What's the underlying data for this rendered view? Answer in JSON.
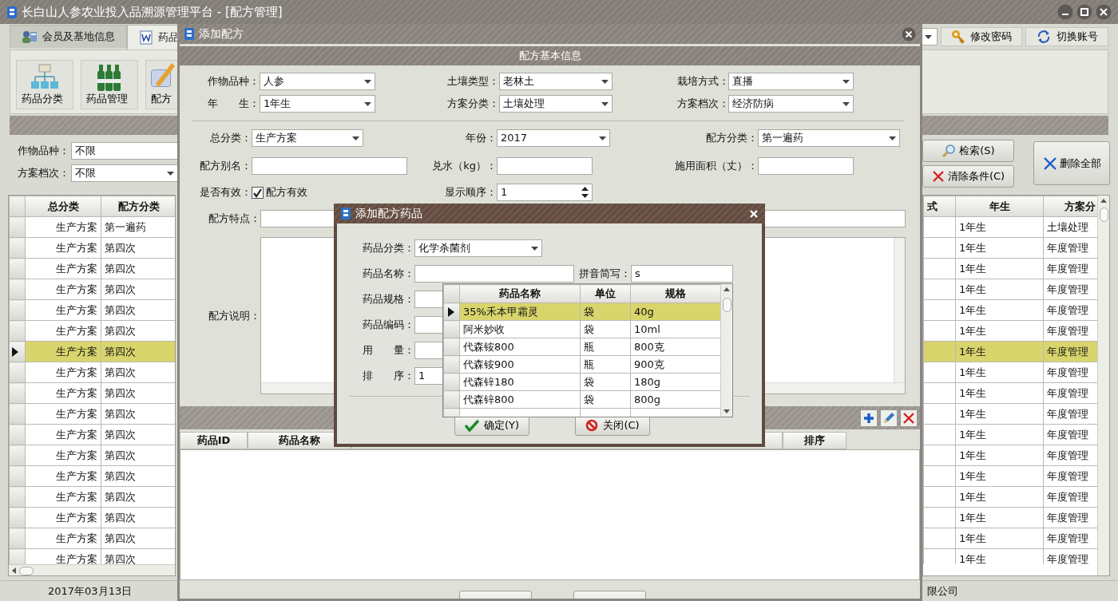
{
  "window": {
    "title": "长白山人参农业投入品溯源管理平台 - [配方管理]"
  },
  "tabs": [
    {
      "label": "会员及基地信息",
      "selected": false
    },
    {
      "label": "药品",
      "selected": true
    }
  ],
  "header_buttons": [
    "修改密码",
    "切换账号"
  ],
  "ribbon": [
    "药品分类",
    "药品管理",
    "配方"
  ],
  "filters": [
    {
      "label": "作物品种：",
      "value": "不限",
      "kind": "text"
    },
    {
      "label": "方案档次：",
      "value": "不限",
      "kind": "combo"
    }
  ],
  "search_buttons": [
    "检索(S)",
    "清除条件(C)"
  ],
  "delete_all_button": "删除全部",
  "records_table": {
    "columns_left": [
      "总分类",
      "配方分类"
    ],
    "columns_right": [
      "式",
      "年生",
      "方案分"
    ],
    "rows": [
      {
        "left": [
          "生产方案",
          "第一遍药"
        ],
        "right": [
          "1年生",
          "土壤处理"
        ],
        "selected": false
      },
      {
        "left": [
          "生产方案",
          "第四次"
        ],
        "right": [
          "1年生",
          "年度管理"
        ],
        "selected": false
      },
      {
        "left": [
          "生产方案",
          "第四次"
        ],
        "right": [
          "1年生",
          "年度管理"
        ],
        "selected": false
      },
      {
        "left": [
          "生产方案",
          "第四次"
        ],
        "right": [
          "1年生",
          "年度管理"
        ],
        "selected": false
      },
      {
        "left": [
          "生产方案",
          "第四次"
        ],
        "right": [
          "1年生",
          "年度管理"
        ],
        "selected": false
      },
      {
        "left": [
          "生产方案",
          "第四次"
        ],
        "right": [
          "1年生",
          "年度管理"
        ],
        "selected": false
      },
      {
        "left": [
          "生产方案",
          "第四次"
        ],
        "right": [
          "1年生",
          "年度管理"
        ],
        "selected": true
      },
      {
        "left": [
          "生产方案",
          "第四次"
        ],
        "right": [
          "1年生",
          "年度管理"
        ],
        "selected": false
      },
      {
        "left": [
          "生产方案",
          "第四次"
        ],
        "right": [
          "1年生",
          "年度管理"
        ],
        "selected": false
      },
      {
        "left": [
          "生产方案",
          "第四次"
        ],
        "right": [
          "1年生",
          "年度管理"
        ],
        "selected": false
      },
      {
        "left": [
          "生产方案",
          "第四次"
        ],
        "right": [
          "1年生",
          "年度管理"
        ],
        "selected": false
      },
      {
        "left": [
          "生产方案",
          "第四次"
        ],
        "right": [
          "1年生",
          "年度管理"
        ],
        "selected": false
      },
      {
        "left": [
          "生产方案",
          "第四次"
        ],
        "right": [
          "1年生",
          "年度管理"
        ],
        "selected": false
      },
      {
        "left": [
          "生产方案",
          "第四次"
        ],
        "right": [
          "1年生",
          "年度管理"
        ],
        "selected": false
      },
      {
        "left": [
          "生产方案",
          "第四次"
        ],
        "right": [
          "1年生",
          "年度管理"
        ],
        "selected": false
      },
      {
        "left": [
          "生产方案",
          "第四次"
        ],
        "right": [
          "1年生",
          "年度管理"
        ],
        "selected": false
      },
      {
        "left": [
          "生产方案",
          "第四次"
        ],
        "right": [
          "1年生",
          "年度管理"
        ],
        "selected": false
      }
    ]
  },
  "status_bar": {
    "date": "2017年03月13日",
    "company": "限公司"
  },
  "recipe_dialog": {
    "title": "添加配方",
    "section": "配方基本信息",
    "form_rows": [
      [
        {
          "label": "作物品种：",
          "kind": "combo",
          "value": "人参"
        },
        {
          "label": "土壤类型：",
          "kind": "combo",
          "value": "老林土"
        },
        {
          "label": "栽培方式：",
          "kind": "combo",
          "value": "直播"
        }
      ],
      [
        {
          "label": "年　　生：",
          "kind": "combo",
          "value": "1年生"
        },
        {
          "label": "方案分类：",
          "kind": "combo",
          "value": "土壤处理"
        },
        {
          "label": "方案档次：",
          "kind": "combo",
          "value": "经济防病"
        }
      ],
      [
        {
          "label": "总分类：",
          "kind": "combo",
          "value": "生产方案"
        },
        {
          "label": "年份：",
          "kind": "combo",
          "value": "2017"
        },
        {
          "label": "配方分类：",
          "kind": "combo",
          "value": "第一遍药"
        }
      ],
      [
        {
          "label": "配方别名：",
          "kind": "text"
        },
        {
          "label": "兑水（kg）：",
          "kind": "text"
        },
        {
          "label": "施用面积（丈）：",
          "kind": "text"
        }
      ],
      [
        {
          "label": "是否有效：",
          "kind": "check",
          "text": "配方有效",
          "checked": true
        },
        {
          "label": "显示顺序：",
          "kind": "spin",
          "value": "1"
        }
      ],
      [
        {
          "label": "配方特点：",
          "kind": "text"
        }
      ],
      [
        {
          "label": "配方说明：",
          "kind": "textarea"
        }
      ]
    ],
    "grid_columns": [
      "药品ID",
      "药品名称",
      "排序"
    ]
  },
  "drug_dialog": {
    "title": "添加配方药品",
    "fields": [
      {
        "label": "药品分类：",
        "kind": "combo",
        "value": "化学杀菌剂"
      },
      {
        "label": "药品名称：",
        "kind": "text"
      },
      {
        "label": "药品规格：",
        "kind": "text"
      },
      {
        "label": "药品编码：",
        "kind": "text"
      },
      {
        "label": "用　　量：",
        "kind": "text"
      },
      {
        "label": "排　　序：",
        "kind": "text",
        "value": "1"
      }
    ],
    "pinyin": {
      "label": "拼音简写：",
      "value": "s"
    },
    "buttons": [
      "确定(Y)",
      "关闭(C)"
    ]
  },
  "drug_picker": {
    "columns": [
      "药品名称",
      "单位",
      "规格"
    ],
    "rows": [
      {
        "cells": [
          "35%禾本甲霜灵",
          "袋",
          "40g"
        ],
        "selected": true
      },
      {
        "cells": [
          "阿米妙收",
          "袋",
          "10ml"
        ],
        "selected": false
      },
      {
        "cells": [
          "代森铵800",
          "瓶",
          "800克"
        ],
        "selected": false
      },
      {
        "cells": [
          "代森铵900",
          "瓶",
          "900克"
        ],
        "selected": false
      },
      {
        "cells": [
          "代森锌180",
          "袋",
          "180g"
        ],
        "selected": false
      },
      {
        "cells": [
          "代森锌800",
          "袋",
          "800g"
        ],
        "selected": false
      }
    ]
  }
}
